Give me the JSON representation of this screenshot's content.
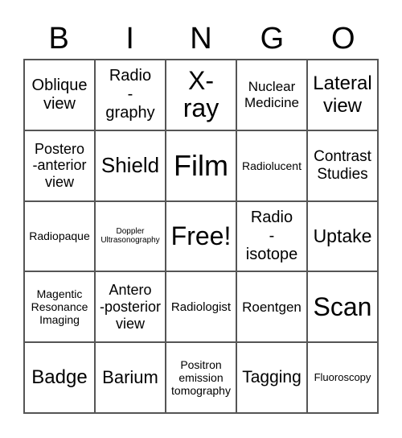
{
  "header": [
    "B",
    "I",
    "N",
    "G",
    "O"
  ],
  "cells": [
    "Oblique\nview",
    "Radio\n-\ngraphy",
    "X-\nray",
    "Nuclear\nMedicine",
    "Lateral\nview",
    "Postero\n-anterior\nview",
    "Shield",
    "Film",
    "Radiolucent",
    "Contrast\nStudies",
    "Radiopaque",
    "Doppler\nUltrasonography",
    "Free!",
    "Radio\n-\nisotope",
    "Uptake",
    "Magentic\nResonance\nImaging",
    "Antero\n-posterior\nview",
    "Radiologist",
    "Roentgen",
    "Scan",
    "Badge",
    "Barium",
    "Positron\nemission\ntomography",
    "Tagging",
    "Fluoroscopy"
  ]
}
